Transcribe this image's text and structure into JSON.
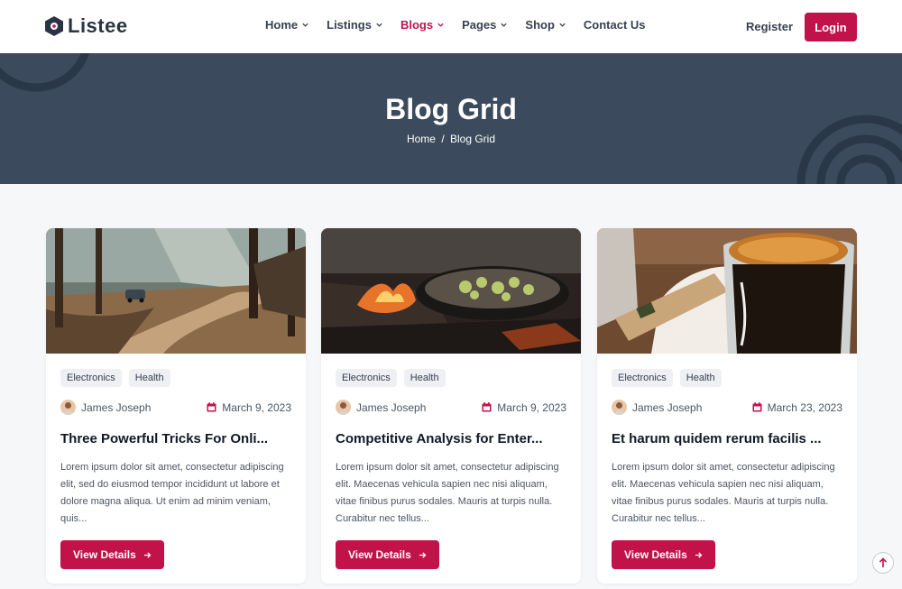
{
  "header": {
    "logo_text": "Listee",
    "nav": [
      {
        "label": "Home",
        "has_dropdown": true,
        "active": false
      },
      {
        "label": "Listings",
        "has_dropdown": true,
        "active": false
      },
      {
        "label": "Blogs",
        "has_dropdown": true,
        "active": true
      },
      {
        "label": "Pages",
        "has_dropdown": true,
        "active": false
      },
      {
        "label": "Shop",
        "has_dropdown": true,
        "active": false
      },
      {
        "label": "Contact Us",
        "has_dropdown": false,
        "active": false
      }
    ],
    "register_label": "Register",
    "login_label": "Login"
  },
  "hero": {
    "title": "Blog Grid",
    "breadcrumb": {
      "home": "Home",
      "separator": "/",
      "current": "Blog Grid"
    }
  },
  "cards": [
    {
      "tags": [
        "Electronics",
        "Health"
      ],
      "author": "James Joseph",
      "date": "March 9, 2023",
      "title": "Three Powerful Tricks For Onli...",
      "excerpt": "Lorem ipsum dolor sit amet, consectetur adipiscing elit, sed do eiusmod tempor incididunt ut labore et dolore magna aliqua. Ut enim ad minim veniam, quis...",
      "button": "View Details",
      "image": "mountain-road"
    },
    {
      "tags": [
        "Electronics",
        "Health"
      ],
      "author": "James Joseph",
      "date": "March 9, 2023",
      "title": "Competitive Analysis for Enter...",
      "excerpt": "Lorem ipsum dolor sit amet, consectetur adipiscing elit. Maecenas vehicula sapien nec nisi aliquam, vitae finibus purus sodales. Mauris at turpis nulla. Curabitur nec tellus...",
      "button": "View Details",
      "image": "campfire-skillet"
    },
    {
      "tags": [
        "Electronics",
        "Health"
      ],
      "author": "James Joseph",
      "date": "March 23, 2023",
      "title": "Et harum quidem rerum facilis ...",
      "excerpt": "Lorem ipsum dolor sit amet, consectetur adipiscing elit. Maecenas vehicula sapien nec nisi aliquam, vitae finibus purus sodales. Mauris at turpis nulla. Curabitur nec tellus...",
      "button": "View Details",
      "image": "espresso-cup"
    }
  ],
  "colors": {
    "accent": "#c1124a",
    "hero_bg": "#3b4a5c",
    "page_bg": "#f6f7f9"
  },
  "icons": [
    "logo-icon",
    "chevron-down-icon",
    "calendar-icon",
    "arrow-right-icon",
    "arrow-up-icon"
  ]
}
